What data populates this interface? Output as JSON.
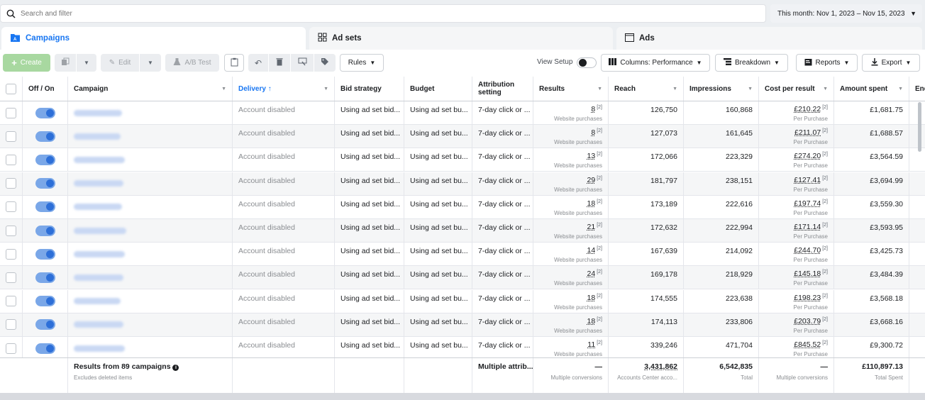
{
  "search": {
    "placeholder": "Search and filter",
    "date_range": "This month: Nov 1, 2023 – Nov 15, 2023"
  },
  "tabs": [
    {
      "label": "Campaigns",
      "icon": "campaigns-icon"
    },
    {
      "label": "Ad sets",
      "icon": "ad-sets-icon"
    },
    {
      "label": "Ads",
      "icon": "ads-icon"
    }
  ],
  "toolbar": {
    "create": "Create",
    "edit": "Edit",
    "ab_test": "A/B Test",
    "rules": "Rules",
    "view_setup": "View Setup",
    "columns": "Columns: Performance",
    "breakdown": "Breakdown",
    "reports": "Reports",
    "export": "Export"
  },
  "columns": {
    "off_on": "Off / On",
    "campaign": "Campaign",
    "delivery": "Delivery",
    "bid_strategy": "Bid strategy",
    "budget": "Budget",
    "attribution": "Attribution setting",
    "results": "Results",
    "reach": "Reach",
    "impressions": "Impressions",
    "cost_per_result": "Cost per result",
    "amount_spent": "Amount spent",
    "ends": "End"
  },
  "rows": [
    {
      "delivery": "Account disabled",
      "bid": "Using ad set bid...",
      "budget": "Using ad set bu...",
      "attr": "7-day click or ...",
      "results": "8",
      "results_sub": "Website purchases",
      "reach": "126,750",
      "impressions": "160,868",
      "cpr": "£210.22",
      "cpr_sub": "Per Purchase",
      "spent": "£1,681.75"
    },
    {
      "delivery": "Account disabled",
      "bid": "Using ad set bid...",
      "budget": "Using ad set bu...",
      "attr": "7-day click or ...",
      "results": "8",
      "results_sub": "Website purchases",
      "reach": "127,073",
      "impressions": "161,645",
      "cpr": "£211.07",
      "cpr_sub": "Per Purchase",
      "spent": "£1,688.57"
    },
    {
      "delivery": "Account disabled",
      "bid": "Using ad set bid...",
      "budget": "Using ad set bu...",
      "attr": "7-day click or ...",
      "results": "13",
      "results_sub": "Website purchases",
      "reach": "172,066",
      "impressions": "223,329",
      "cpr": "£274.20",
      "cpr_sub": "Per Purchase",
      "spent": "£3,564.59"
    },
    {
      "delivery": "Account disabled",
      "bid": "Using ad set bid...",
      "budget": "Using ad set bu...",
      "attr": "7-day click or ...",
      "results": "29",
      "results_sub": "Website purchases",
      "reach": "181,797",
      "impressions": "238,151",
      "cpr": "£127.41",
      "cpr_sub": "Per Purchase",
      "spent": "£3,694.99"
    },
    {
      "delivery": "Account disabled",
      "bid": "Using ad set bid...",
      "budget": "Using ad set bu...",
      "attr": "7-day click or ...",
      "results": "18",
      "results_sub": "Website purchases",
      "reach": "173,189",
      "impressions": "222,616",
      "cpr": "£197.74",
      "cpr_sub": "Per Purchase",
      "spent": "£3,559.30"
    },
    {
      "delivery": "Account disabled",
      "bid": "Using ad set bid...",
      "budget": "Using ad set bu...",
      "attr": "7-day click or ...",
      "results": "21",
      "results_sub": "Website purchases",
      "reach": "172,632",
      "impressions": "222,994",
      "cpr": "£171.14",
      "cpr_sub": "Per Purchase",
      "spent": "£3,593.95"
    },
    {
      "delivery": "Account disabled",
      "bid": "Using ad set bid...",
      "budget": "Using ad set bu...",
      "attr": "7-day click or ...",
      "results": "14",
      "results_sub": "Website purchases",
      "reach": "167,639",
      "impressions": "214,092",
      "cpr": "£244.70",
      "cpr_sub": "Per Purchase",
      "spent": "£3,425.73"
    },
    {
      "delivery": "Account disabled",
      "bid": "Using ad set bid...",
      "budget": "Using ad set bu...",
      "attr": "7-day click or ...",
      "results": "24",
      "results_sub": "Website purchases",
      "reach": "169,178",
      "impressions": "218,929",
      "cpr": "£145.18",
      "cpr_sub": "Per Purchase",
      "spent": "£3,484.39"
    },
    {
      "delivery": "Account disabled",
      "bid": "Using ad set bid...",
      "budget": "Using ad set bu...",
      "attr": "7-day click or ...",
      "results": "18",
      "results_sub": "Website purchases",
      "reach": "174,555",
      "impressions": "223,638",
      "cpr": "£198.23",
      "cpr_sub": "Per Purchase",
      "spent": "£3,568.18"
    },
    {
      "delivery": "Account disabled",
      "bid": "Using ad set bid...",
      "budget": "Using ad set bu...",
      "attr": "7-day click or ...",
      "results": "18",
      "results_sub": "Website purchases",
      "reach": "174,113",
      "impressions": "233,806",
      "cpr": "£203.79",
      "cpr_sub": "Per Purchase",
      "spent": "£3,668.16"
    },
    {
      "delivery": "Account disabled",
      "bid": "Using ad set bid...",
      "budget": "Using ad set bu...",
      "attr": "7-day click or ...",
      "results": "11",
      "results_sub": "Website purchases",
      "reach": "339,246",
      "impressions": "471,704",
      "cpr": "£845.52",
      "cpr_sub": "Per Purchase",
      "spent": "£9,300.72"
    }
  ],
  "footer": {
    "results_from": "Results from 89 campaigns",
    "excludes": "Excludes deleted items",
    "attribution": "Multiple attrib...",
    "results": "—",
    "results_sub": "Multiple conversions",
    "reach": "3,431,862",
    "reach_sub": "Accounts Center acco...",
    "impressions": "6,542,835",
    "impressions_sub": "Total",
    "cpr": "—",
    "cpr_sub": "Multiple conversions",
    "spent": "£110,897.13",
    "spent_sub": "Total Spent"
  },
  "colors": {
    "accent": "#1876f2",
    "create_button": "#a8d8a0",
    "toggle_on": "#2d6fd8"
  }
}
